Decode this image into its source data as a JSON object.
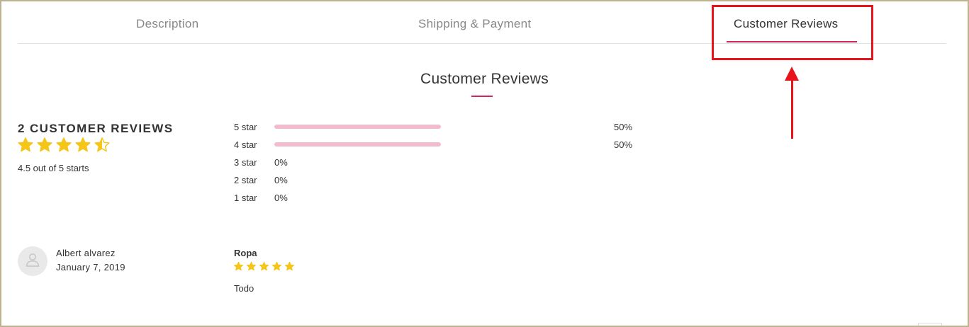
{
  "tabs": [
    {
      "label": "Description"
    },
    {
      "label": "Shipping & Payment"
    },
    {
      "label": "Customer Reviews"
    }
  ],
  "active_tab": "Customer Reviews",
  "section_title": "Customer Reviews",
  "summary": {
    "count_title": "2 CUSTOMER REVIEWS",
    "rating_value": 4.5,
    "rating_text": "4.5 out of 5 starts"
  },
  "distribution": [
    {
      "label": "5 star",
      "percent_text": "50%",
      "percent": 50
    },
    {
      "label": "4 star",
      "percent_text": "50%",
      "percent": 50
    },
    {
      "label": "3 star",
      "percent_text": "0%",
      "percent": 0
    },
    {
      "label": "2 star",
      "percent_text": "0%",
      "percent": 0
    },
    {
      "label": "1 star",
      "percent_text": "0%",
      "percent": 0
    }
  ],
  "reviews": [
    {
      "author": "Albert alvarez",
      "date": "January 7, 2019",
      "title": "Ropa",
      "rating": 5,
      "body": "Todo",
      "avatar_icon": "user-icon"
    }
  ],
  "colors": {
    "accent": "#d6245e",
    "star": "#f5c518",
    "bar_fill": "#f1bcd0",
    "annotation": "#e8141b"
  }
}
